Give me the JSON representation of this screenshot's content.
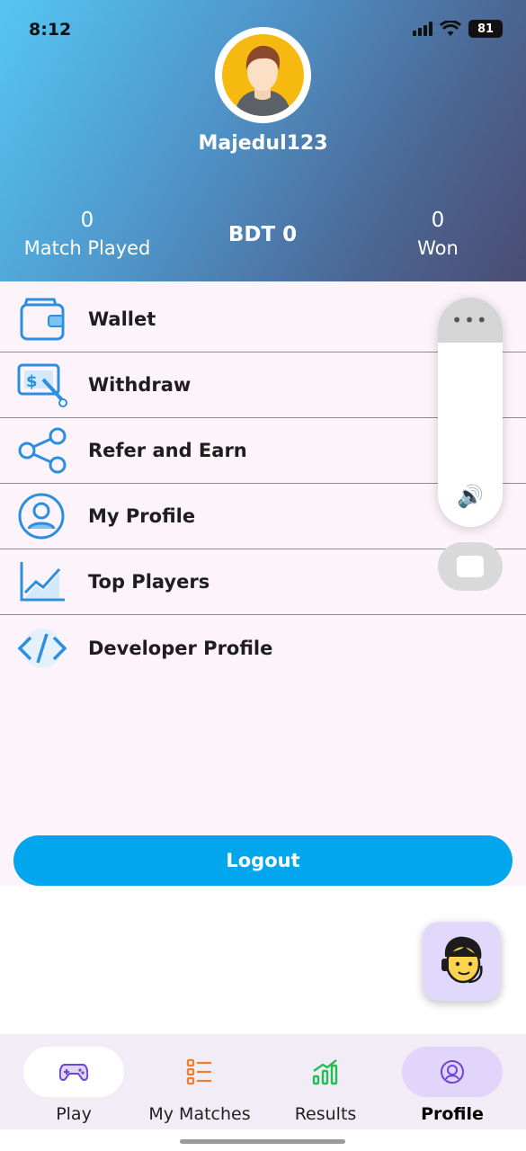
{
  "status_bar": {
    "time": "8:12",
    "battery": "81"
  },
  "profile": {
    "username": "Majedul123"
  },
  "stats": {
    "matches_played_value": "0",
    "matches_played_label": "Match Played",
    "balance": "BDT 0",
    "won_value": "0",
    "won_label": "Won"
  },
  "menu": {
    "items": [
      {
        "label": "Wallet",
        "icon": "wallet-icon"
      },
      {
        "label": "Withdraw",
        "icon": "withdraw-icon"
      },
      {
        "label": "Refer and Earn",
        "icon": "share-icon"
      },
      {
        "label": "My Profile",
        "icon": "user-profile-icon"
      },
      {
        "label": "Top Players",
        "icon": "chart-icon"
      },
      {
        "label": "Developer Profile",
        "icon": "code-icon"
      }
    ]
  },
  "floating_panel": {
    "dots": "•••"
  },
  "logout": {
    "label": "Logout"
  },
  "bottom_nav": {
    "items": [
      {
        "label": "Play",
        "icon": "gamepad-icon"
      },
      {
        "label": "My Matches",
        "icon": "list-icon"
      },
      {
        "label": "Results",
        "icon": "results-chart-icon"
      },
      {
        "label": "Profile",
        "icon": "profile-icon"
      }
    ],
    "active": "Profile"
  },
  "colors": {
    "accent": "#02a6ec",
    "icon_blue": "#2a8fe0",
    "menu_background": "#fdf3fb",
    "nav_active_pill": "#e1d5fb"
  }
}
